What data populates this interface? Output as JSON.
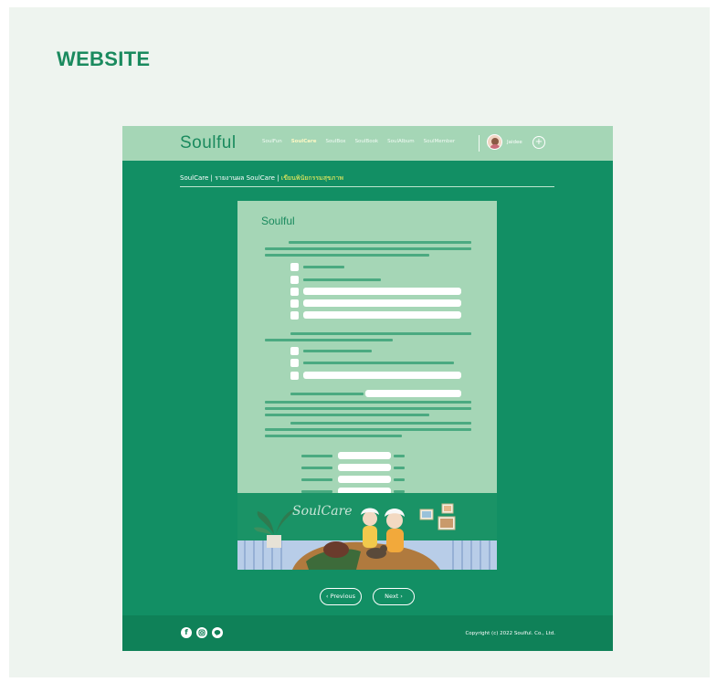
{
  "section_title": "WEBSITE",
  "nav": {
    "logo": "Soulful",
    "links": [
      "SoulFun",
      "SoulCare",
      "SoulBox",
      "SoulBook",
      "SoulAlbum",
      "SoulMember"
    ],
    "active_index": 1,
    "user_name": "Jaidee",
    "plus_label": "+"
  },
  "breadcrumb": {
    "prefix": "SoulCare | รายงานผล SoulCare | ",
    "current": "เขียนพินัยกรรมสุขภาพ"
  },
  "form": {
    "logo": "Soulful"
  },
  "buttons": {
    "previous": "‹ Previous",
    "next": "Next ›"
  },
  "footer": {
    "copyright": "Copyright (c) 2022 Soulful. Co., Ltd."
  },
  "colors": {
    "brand_green": "#128f64",
    "nav_green": "#a5d6b6",
    "accent_yellow": "#fff35c"
  }
}
